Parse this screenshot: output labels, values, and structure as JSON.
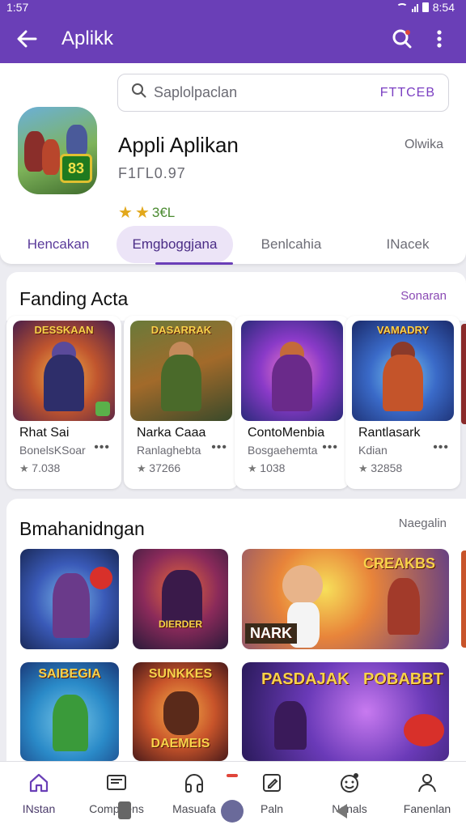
{
  "status_bar": {
    "time": "1:57",
    "battery": "8:54"
  },
  "app_bar": {
    "title": "Aplikk"
  },
  "search": {
    "placeholder": "Saplolpaclan",
    "filter_label": "FTTCEB"
  },
  "app": {
    "icon_text": "83",
    "name": "Appli Aplikan",
    "subtitle": "F1ГL0.97",
    "side_label": "Olwika",
    "rating_text": "3€L"
  },
  "tabs": [
    {
      "label": "Hencakan"
    },
    {
      "label": "Emgboggjana"
    },
    {
      "label": "Benlcahia"
    },
    {
      "label": "INacek"
    }
  ],
  "section1": {
    "title": "Fanding Acta",
    "more": "Sonaran",
    "cards": [
      {
        "banner": "DESSKAAN",
        "name": "Rhat Sai",
        "dev": "BonelsKSoar",
        "count": "7.038"
      },
      {
        "banner": "DASARRAK",
        "name": "Narka Caaa",
        "dev": "Ranlaghebta",
        "count": "37266"
      },
      {
        "banner": "",
        "name": "ContoMenbia",
        "dev": "Bosgaehemta",
        "count": "1038"
      },
      {
        "banner": "VAMADRY",
        "name": "Rantlasark",
        "dev": "Kdian",
        "count": "32858"
      }
    ]
  },
  "section2": {
    "title": "Bmahanidngan",
    "more": "Naegalin",
    "tiles": [
      {
        "text": ""
      },
      {
        "text": "DIERDER"
      },
      {
        "text": "NARK"
      },
      {
        "text": "CREAKBS"
      },
      {
        "text": "SAIBEGIA"
      },
      {
        "text": "SUNKKES"
      },
      {
        "text": "DAEMEIS"
      },
      {
        "text": "PASDAJAK"
      },
      {
        "text": "POBABBT"
      }
    ]
  },
  "bottom_nav": [
    {
      "label": "INstan",
      "icon": "home-icon"
    },
    {
      "label": "Compgens",
      "icon": "tv-icon"
    },
    {
      "label": "Masuafa",
      "icon": "headphones-icon"
    },
    {
      "label": "Paln",
      "icon": "edit-icon"
    },
    {
      "label": "Nanals",
      "icon": "emoji-icon"
    },
    {
      "label": "Fanenlan",
      "icon": "person-icon"
    }
  ],
  "colors": {
    "primary": "#6a3fb7",
    "accent": "#8a4ab4",
    "star": "#e2a81c"
  }
}
